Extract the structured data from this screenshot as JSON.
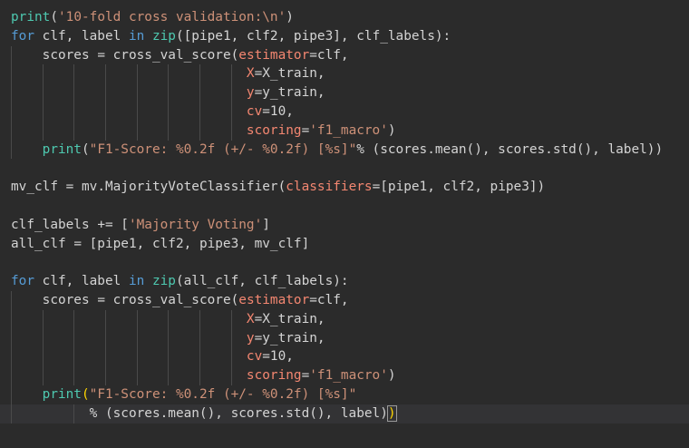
{
  "editor": {
    "lines": [
      {
        "indent": 0,
        "tokens": [
          {
            "t": "print",
            "k": "builtin"
          },
          {
            "t": "(",
            "k": "plain"
          },
          {
            "t": "'10-fold cross validation:\\n'",
            "k": "string"
          },
          {
            "t": ")",
            "k": "plain"
          }
        ]
      },
      {
        "indent": 0,
        "tokens": [
          {
            "t": "for",
            "k": "keyword"
          },
          {
            "t": " clf, label ",
            "k": "plain"
          },
          {
            "t": "in",
            "k": "keyword"
          },
          {
            "t": " ",
            "k": "plain"
          },
          {
            "t": "zip",
            "k": "builtin"
          },
          {
            "t": "([pipe1, clf2, pipe3], clf_labels):",
            "k": "plain"
          }
        ]
      },
      {
        "indent": 1,
        "tokens": [
          {
            "t": "    scores ",
            "k": "plain"
          },
          {
            "t": "=",
            "k": "operator"
          },
          {
            "t": " cross_val_score(",
            "k": "plain"
          },
          {
            "t": "estimator",
            "k": "kwarg"
          },
          {
            "t": "=clf,",
            "k": "plain"
          }
        ]
      },
      {
        "indent": 2,
        "tokens": [
          {
            "t": "                              ",
            "k": "plain"
          },
          {
            "t": "X",
            "k": "kwarg"
          },
          {
            "t": "=X_train,",
            "k": "plain"
          }
        ]
      },
      {
        "indent": 2,
        "tokens": [
          {
            "t": "                              ",
            "k": "plain"
          },
          {
            "t": "y",
            "k": "kwarg"
          },
          {
            "t": "=y_train,",
            "k": "plain"
          }
        ]
      },
      {
        "indent": 2,
        "tokens": [
          {
            "t": "                              ",
            "k": "plain"
          },
          {
            "t": "cv",
            "k": "kwarg"
          },
          {
            "t": "=10,",
            "k": "plain"
          }
        ]
      },
      {
        "indent": 2,
        "tokens": [
          {
            "t": "                              ",
            "k": "plain"
          },
          {
            "t": "scoring",
            "k": "kwarg"
          },
          {
            "t": "=",
            "k": "plain"
          },
          {
            "t": "'f1_macro'",
            "k": "string"
          },
          {
            "t": ")",
            "k": "plain"
          }
        ]
      },
      {
        "indent": 1,
        "tokens": [
          {
            "t": "    ",
            "k": "plain"
          },
          {
            "t": "print",
            "k": "builtin"
          },
          {
            "t": "(",
            "k": "plain"
          },
          {
            "t": "\"F1-Score: %0.2f (+/- %0.2f) [%s]\"",
            "k": "string"
          },
          {
            "t": "% (scores.mean(), scores.std(), label))",
            "k": "plain"
          }
        ]
      },
      {
        "indent": 0,
        "tokens": []
      },
      {
        "indent": 0,
        "tokens": [
          {
            "t": "mv_clf ",
            "k": "plain"
          },
          {
            "t": "=",
            "k": "operator"
          },
          {
            "t": " mv.MajorityVoteClassifier(",
            "k": "plain"
          },
          {
            "t": "classifiers",
            "k": "kwarg"
          },
          {
            "t": "=[pipe1, clf2, pipe3])",
            "k": "plain"
          }
        ]
      },
      {
        "indent": 0,
        "tokens": []
      },
      {
        "indent": 0,
        "tokens": [
          {
            "t": "clf_labels ",
            "k": "plain"
          },
          {
            "t": "+=",
            "k": "operator"
          },
          {
            "t": " [",
            "k": "plain"
          },
          {
            "t": "'Majority Voting'",
            "k": "string"
          },
          {
            "t": "]",
            "k": "plain"
          }
        ]
      },
      {
        "indent": 0,
        "tokens": [
          {
            "t": "all_clf ",
            "k": "plain"
          },
          {
            "t": "=",
            "k": "operator"
          },
          {
            "t": " [pipe1, clf2, pipe3, mv_clf]",
            "k": "plain"
          }
        ]
      },
      {
        "indent": 0,
        "tokens": []
      },
      {
        "indent": 0,
        "tokens": [
          {
            "t": "for",
            "k": "keyword"
          },
          {
            "t": " clf, label ",
            "k": "plain"
          },
          {
            "t": "in",
            "k": "keyword"
          },
          {
            "t": " ",
            "k": "plain"
          },
          {
            "t": "zip",
            "k": "builtin"
          },
          {
            "t": "(all_clf, clf_labels):",
            "k": "plain"
          }
        ]
      },
      {
        "indent": 1,
        "tokens": [
          {
            "t": "    scores ",
            "k": "plain"
          },
          {
            "t": "=",
            "k": "operator"
          },
          {
            "t": " cross_val_score(",
            "k": "plain"
          },
          {
            "t": "estimator",
            "k": "kwarg"
          },
          {
            "t": "=clf,",
            "k": "plain"
          }
        ]
      },
      {
        "indent": 2,
        "tokens": [
          {
            "t": "                              ",
            "k": "plain"
          },
          {
            "t": "X",
            "k": "kwarg"
          },
          {
            "t": "=X_train,",
            "k": "plain"
          }
        ]
      },
      {
        "indent": 2,
        "tokens": [
          {
            "t": "                              ",
            "k": "plain"
          },
          {
            "t": "y",
            "k": "kwarg"
          },
          {
            "t": "=y_train,",
            "k": "plain"
          }
        ]
      },
      {
        "indent": 2,
        "tokens": [
          {
            "t": "                              ",
            "k": "plain"
          },
          {
            "t": "cv",
            "k": "kwarg"
          },
          {
            "t": "=10,",
            "k": "plain"
          }
        ]
      },
      {
        "indent": 2,
        "tokens": [
          {
            "t": "                              ",
            "k": "plain"
          },
          {
            "t": "scoring",
            "k": "kwarg"
          },
          {
            "t": "=",
            "k": "plain"
          },
          {
            "t": "'f1_macro'",
            "k": "string"
          },
          {
            "t": ")",
            "k": "plain"
          }
        ]
      },
      {
        "indent": 1,
        "tokens": [
          {
            "t": "    ",
            "k": "plain"
          },
          {
            "t": "print",
            "k": "builtin"
          },
          {
            "t": "(",
            "k": "bracket"
          },
          {
            "t": "\"F1-Score: %0.2f (+/- %0.2f) [%s]\"",
            "k": "string"
          }
        ]
      },
      {
        "indent": 3,
        "current": true,
        "tokens": [
          {
            "t": "          ",
            "k": "plain"
          },
          {
            "t": "% (scores.mean(), scores.std(), label)",
            "k": "plain"
          },
          {
            "t": ")",
            "k": "bracket",
            "cursor": true
          }
        ]
      }
    ]
  },
  "colors": {
    "background": "#2b2b2b",
    "keyword": "#569cd6",
    "builtin": "#4ec9b0",
    "string": "#ce9178",
    "kwarg": "#f48771",
    "text": "#d4d4d4"
  }
}
